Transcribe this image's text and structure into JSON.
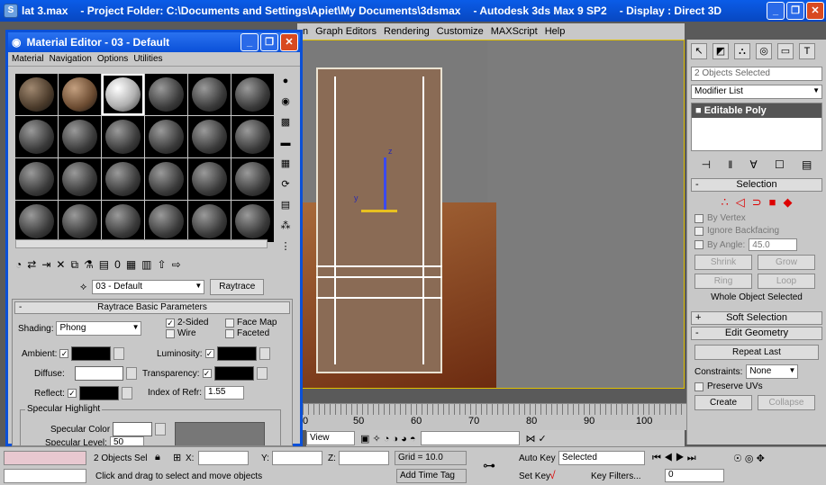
{
  "titlebar": {
    "app_file": "lat 3.max",
    "project": "- Project Folder: C:\\Documents and Settings\\Apiet\\My Documents\\3dsmax",
    "app_name": "- Autodesk 3ds Max 9 SP2",
    "display": "- Display : Direct 3D"
  },
  "menubar": [
    "n",
    "Graph Editors",
    "Rendering",
    "Customize",
    "MAXScript",
    "Help"
  ],
  "viewport": {
    "axis_z": "z",
    "axis_y": "y"
  },
  "timeline": {
    "ticks": [
      "0",
      "50",
      "60",
      "70",
      "80",
      "90",
      "100"
    ]
  },
  "viewbar": {
    "view_label": "View"
  },
  "command_panel": {
    "selection_name": "2 Objects Selected",
    "modifier_list": "Modifier List",
    "stack_item": "Editable Poly",
    "selection_rollout": {
      "title": "Selection",
      "by_vertex": "By Vertex",
      "ignore_backfacing": "Ignore Backfacing",
      "by_angle": "By Angle:",
      "by_angle_value": "45.0",
      "shrink": "Shrink",
      "grow": "Grow",
      "ring": "Ring",
      "loop": "Loop",
      "whole_object": "Whole Object Selected"
    },
    "soft_selection": "Soft Selection",
    "edit_geometry": "Edit Geometry",
    "repeat_last": "Repeat Last",
    "constraints_label": "Constraints:",
    "constraints_value": "None",
    "preserve_uvs": "Preserve UVs",
    "create": "Create",
    "collapse": "Collapse"
  },
  "status": {
    "objects_selected": "2 Objects Sel",
    "x_label": "X:",
    "y_label": "Y:",
    "z_label": "Z:",
    "grid": "Grid = 10.0",
    "auto_key": "Auto Key",
    "selected": "Selected",
    "set_key": "Set Key",
    "key_filters": "Key Filters...",
    "frame": "0",
    "prompt": "Click and drag to select and move objects",
    "add_time_tag": "Add Time Tag"
  },
  "material_editor": {
    "title": "Material Editor - 03 - Default",
    "menu": [
      "Material",
      "Navigation",
      "Options",
      "Utilities"
    ],
    "material_name": "03 - Default",
    "material_type": "Raytrace",
    "params": {
      "title": "Raytrace Basic Parameters",
      "shading_label": "Shading:",
      "shading_value": "Phong",
      "two_sided": "2-Sided",
      "wire": "Wire",
      "face_map": "Face Map",
      "faceted": "Faceted",
      "ambient": "Ambient:",
      "diffuse": "Diffuse:",
      "reflect": "Reflect:",
      "luminosity": "Luminosity:",
      "transparency": "Transparency:",
      "ior_label": "Index of Refr:",
      "ior_value": "1.55",
      "specular_highlight": "Specular Highlight",
      "specular_color": "Specular Color",
      "specular_level": "Specular Level:",
      "specular_level_value": "50"
    }
  }
}
